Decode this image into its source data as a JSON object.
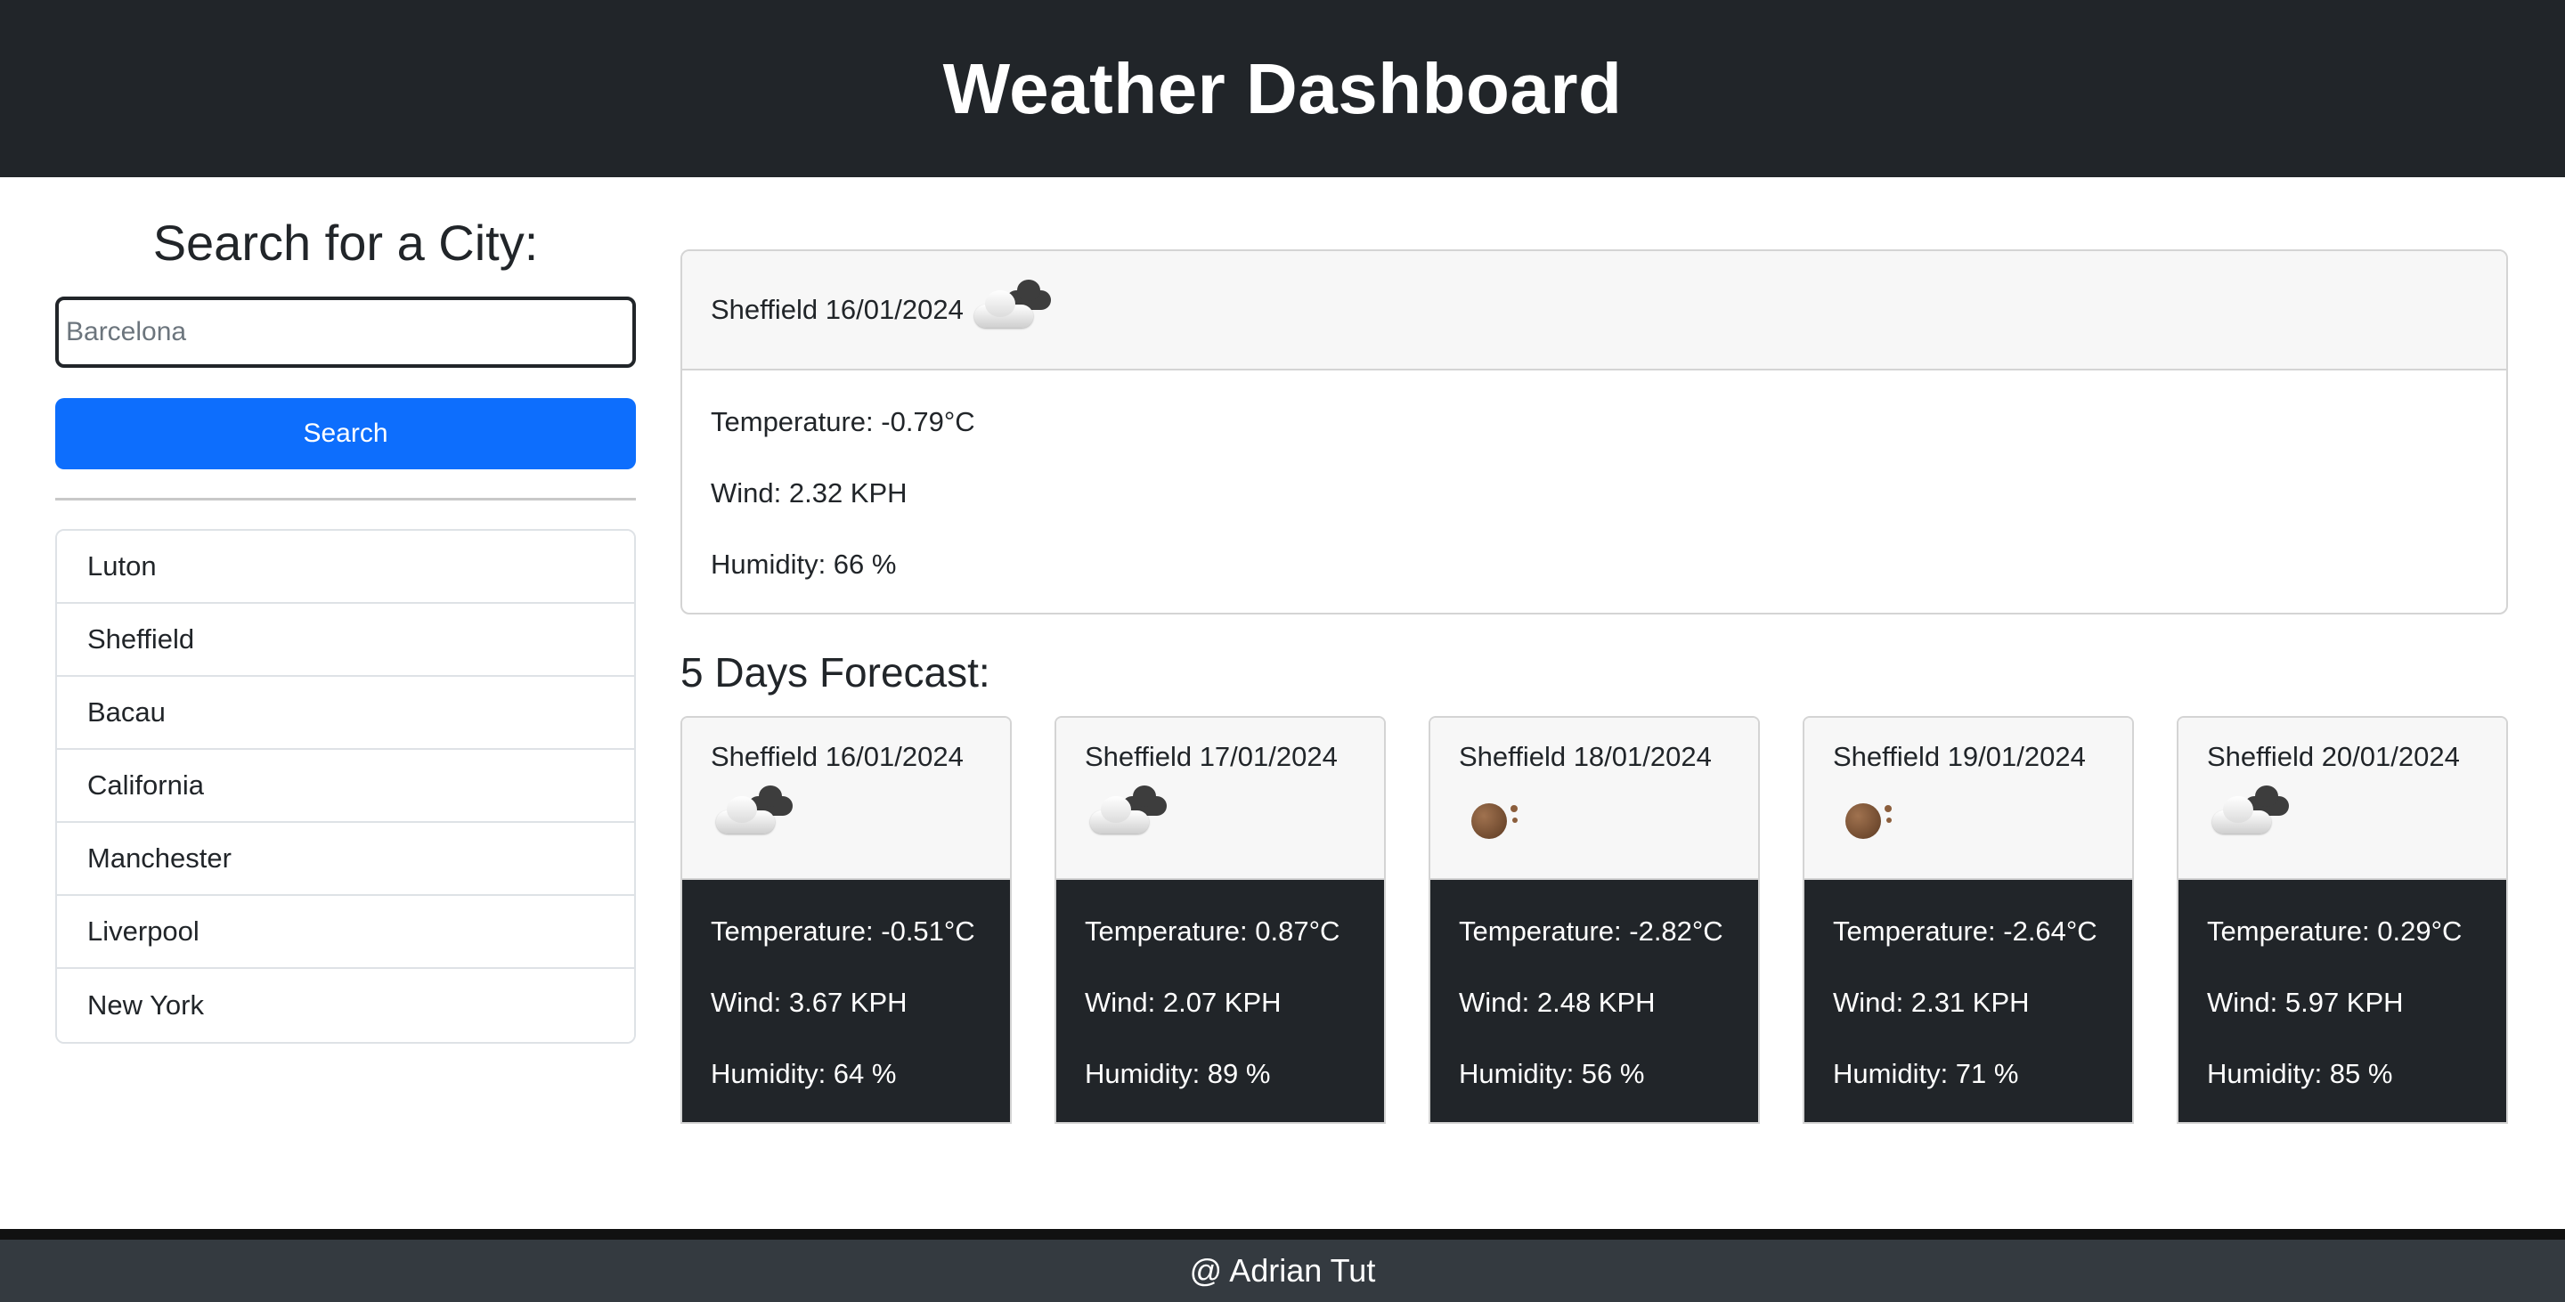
{
  "header": {
    "title": "Weather Dashboard"
  },
  "search": {
    "title": "Search for a City:",
    "placeholder": "Barcelona",
    "button_label": "Search"
  },
  "history": [
    "Luton",
    "Sheffield",
    "Bacau",
    "California",
    "Manchester",
    "Liverpool",
    "New York"
  ],
  "current": {
    "title": "Sheffield 16/01/2024",
    "icon": "cloud-night-icon",
    "temperature": "Temperature: -0.79°C",
    "wind": "Wind: 2.32 KPH",
    "humidity": "Humidity: 66 %"
  },
  "forecast": {
    "title": "5 Days Forecast:",
    "days": [
      {
        "title": "Sheffield 16/01/2024",
        "icon": "cloud-night-icon",
        "temperature": "Temperature: -0.51°C",
        "wind": "Wind: 3.67 KPH",
        "humidity": "Humidity: 64 %"
      },
      {
        "title": "Sheffield 17/01/2024",
        "icon": "cloud-night-icon",
        "temperature": "Temperature: 0.87°C",
        "wind": "Wind: 2.07 KPH",
        "humidity": "Humidity: 89 %"
      },
      {
        "title": "Sheffield 18/01/2024",
        "icon": "clear-night-icon",
        "temperature": "Temperature: -2.82°C",
        "wind": "Wind: 2.48 KPH",
        "humidity": "Humidity: 56 %"
      },
      {
        "title": "Sheffield 19/01/2024",
        "icon": "clear-night-icon",
        "temperature": "Temperature: -2.64°C",
        "wind": "Wind: 2.31 KPH",
        "humidity": "Humidity: 71 %"
      },
      {
        "title": "Sheffield 20/01/2024",
        "icon": "cloud-night-icon",
        "temperature": "Temperature: 0.29°C",
        "wind": "Wind: 5.97 KPH",
        "humidity": "Humidity: 85 %"
      }
    ]
  },
  "footer": {
    "text": "@ Adrian Tut"
  },
  "colors": {
    "header_bg": "#212529",
    "button_bg": "#0d6efd",
    "forecast_body_bg": "#212529",
    "footer_bg": "#343a40"
  }
}
